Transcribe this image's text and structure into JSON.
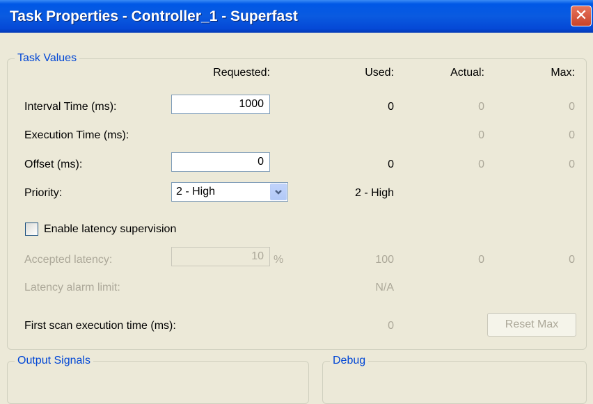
{
  "window": {
    "title": "Task Properties - Controller_1 - Superfast",
    "close_glyph": "✕"
  },
  "task_values": {
    "legend": "Task Values",
    "headers": {
      "requested": "Requested:",
      "used": "Used:",
      "actual": "Actual:",
      "max": "Max:"
    },
    "interval_time": {
      "label": "Interval Time (ms):",
      "requested": "1000",
      "used": "0",
      "actual": "0",
      "max": "0"
    },
    "execution_time": {
      "label": "Execution Time (ms):",
      "actual": "0",
      "max": "0"
    },
    "offset": {
      "label": "Offset (ms):",
      "requested": "0",
      "used": "0",
      "actual": "0",
      "max": "0"
    },
    "priority": {
      "label": "Priority:",
      "selected": "2 - High",
      "used": "2 - High"
    },
    "latency_supervision": {
      "label": "Enable latency supervision",
      "checked": false
    },
    "accepted_latency": {
      "label": "Accepted latency:",
      "requested": "10",
      "unit": "%",
      "used": "100",
      "actual": "0",
      "max": "0"
    },
    "latency_alarm_limit": {
      "label": "Latency alarm limit:",
      "used": "N/A"
    },
    "first_scan": {
      "label": "First scan execution time (ms):",
      "used": "0"
    },
    "reset_max_label": "Reset Max"
  },
  "output_signals": {
    "legend": "Output Signals"
  },
  "debug": {
    "legend": "Debug"
  },
  "icons": {
    "close": "close-icon",
    "dropdown": "chevron-down-icon"
  },
  "colors": {
    "titlebar": "#0058e6",
    "legend_text": "#0046d5",
    "disabled_text": "#aca899",
    "window_bg": "#ece9d8"
  }
}
